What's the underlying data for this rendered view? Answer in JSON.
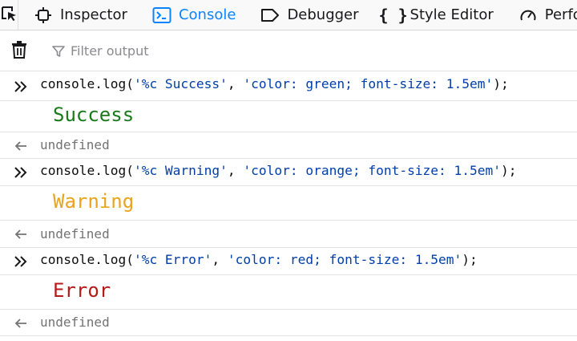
{
  "toolbar": {
    "tabs": [
      {
        "label": "Inspector",
        "icon": "inspector-icon"
      },
      {
        "label": "Console",
        "icon": "console-icon"
      },
      {
        "label": "Debugger",
        "icon": "debugger-icon"
      },
      {
        "label": "Style Editor",
        "icon": "style-editor-icon"
      },
      {
        "label": "Perfor",
        "icon": "performance-icon"
      }
    ],
    "selected_tab": "Console"
  },
  "filter": {
    "placeholder": "Filter output"
  },
  "entries": [
    {
      "command": {
        "fn": "console.log(",
        "arg1": "'%c Success'",
        "sep": ", ",
        "arg2": "'color: green; font-size: 1.5em'",
        "end": ");"
      },
      "output": "Success",
      "output_color": "#1b7a1b",
      "result": "undefined"
    },
    {
      "command": {
        "fn": "console.log(",
        "arg1": "'%c Warning'",
        "sep": ", ",
        "arg2": "'color: orange; font-size: 1.5em'",
        "end": ");"
      },
      "output": "Warning",
      "output_color": "#e8a41c",
      "result": "undefined"
    },
    {
      "command": {
        "fn": "console.log(",
        "arg1": "'%c Error'",
        "sep": ", ",
        "arg2": "'color: red; font-size: 1.5em'",
        "end": ");"
      },
      "output": "Error",
      "output_color": "#b31b1b",
      "result": "undefined"
    }
  ],
  "colors": {
    "accent": "#0a84ff",
    "string": "#003eaa",
    "muted": "#737373"
  }
}
